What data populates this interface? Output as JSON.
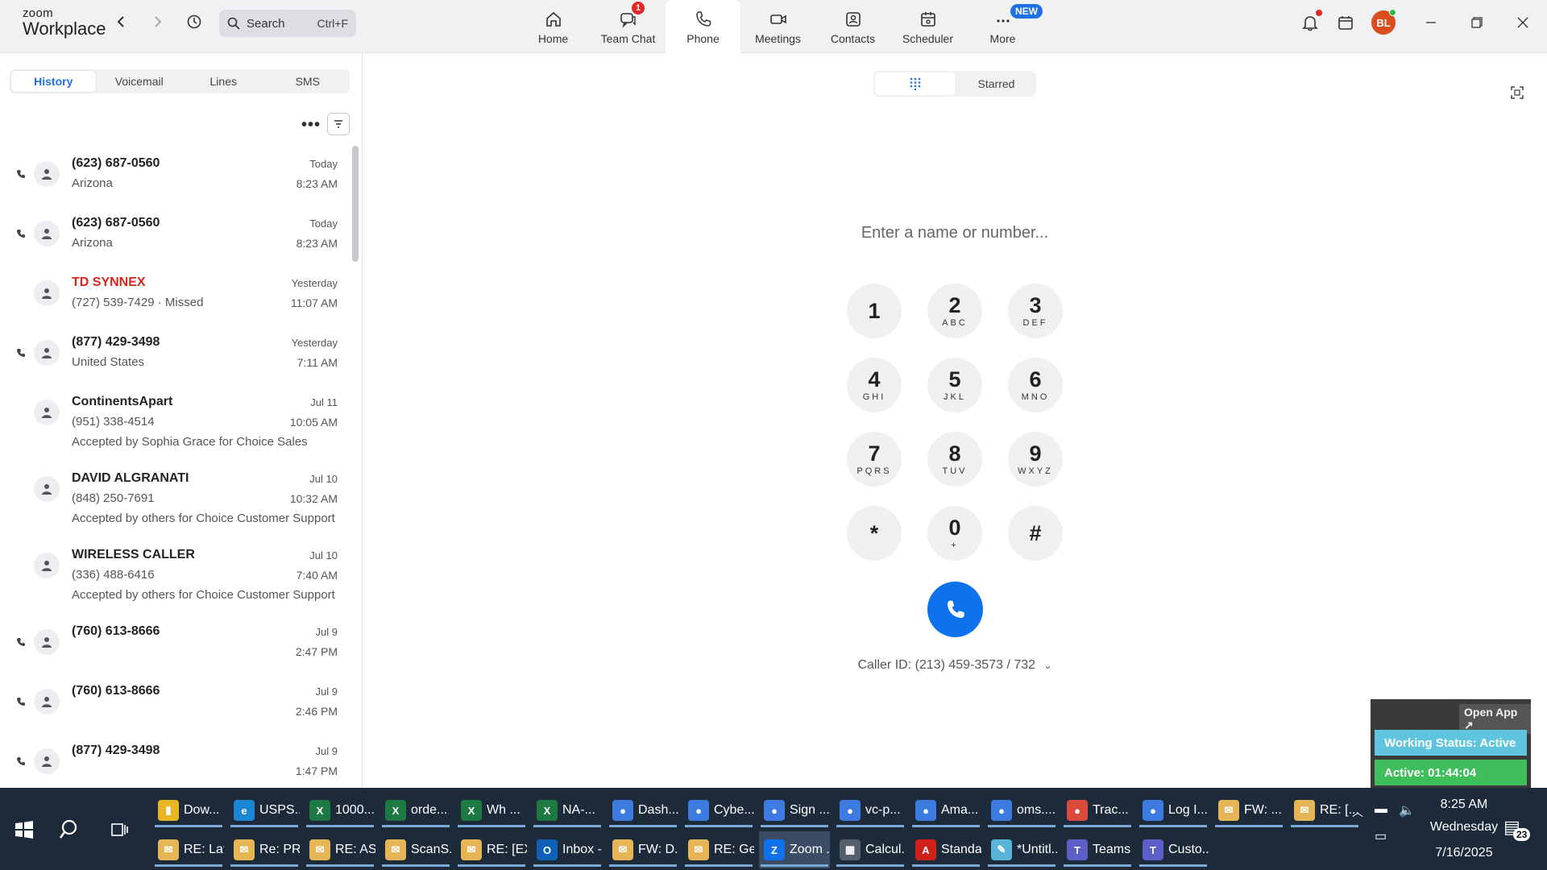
{
  "app": {
    "logo_top": "zoom",
    "logo_bottom": "Workplace"
  },
  "search": {
    "label": "Search",
    "shortcut": "Ctrl+F"
  },
  "tabs": [
    {
      "label": "Home",
      "icon": "home-icon"
    },
    {
      "label": "Team Chat",
      "icon": "chat-icon",
      "badge": "1"
    },
    {
      "label": "Phone",
      "icon": "phone-icon",
      "active": true
    },
    {
      "label": "Meetings",
      "icon": "video-icon"
    },
    {
      "label": "Contacts",
      "icon": "contacts-icon"
    },
    {
      "label": "Scheduler",
      "icon": "calendar-icon"
    },
    {
      "label": "More",
      "icon": "more-icon",
      "badge": "NEW"
    }
  ],
  "user": {
    "initials": "BL"
  },
  "phone": {
    "subtabs": [
      "History",
      "Voicemail",
      "Lines",
      "SMS"
    ],
    "active_subtab": "History",
    "more_label": "•••",
    "history": [
      {
        "name": "(623) 687-0560",
        "sub": "Arizona",
        "sub2": "",
        "day": "Today",
        "time": "8:23 AM",
        "missed": false,
        "dir": true
      },
      {
        "name": "(623) 687-0560",
        "sub": "Arizona",
        "sub2": "",
        "day": "Today",
        "time": "8:23 AM",
        "missed": false,
        "dir": true
      },
      {
        "name": "TD SYNNEX",
        "sub": "(727) 539-7429 · Missed",
        "sub2": "",
        "day": "Yesterday",
        "time": "11:07 AM",
        "missed": true,
        "dir": false
      },
      {
        "name": "(877) 429-3498",
        "sub": "United States",
        "sub2": "",
        "day": "Yesterday",
        "time": "7:11 AM",
        "missed": false,
        "dir": true
      },
      {
        "name": "ContinentsApart",
        "sub": "(951) 338-4514",
        "sub2": "Accepted by Sophia Grace for Choice Sales",
        "day": "Jul 11",
        "time": "10:05 AM",
        "missed": false,
        "dir": false
      },
      {
        "name": "DAVID ALGRANATI",
        "sub": "(848) 250-7691",
        "sub2": "Accepted by others for Choice Customer Support",
        "day": "Jul 10",
        "time": "10:32 AM",
        "missed": false,
        "dir": false
      },
      {
        "name": "WIRELESS CALLER",
        "sub": "(336) 488-6416",
        "sub2": "Accepted by others for Choice Customer Support",
        "day": "Jul 10",
        "time": "7:40 AM",
        "missed": false,
        "dir": false
      },
      {
        "name": "(760) 613-8666",
        "sub": "",
        "sub2": "",
        "day": "Jul 9",
        "time": "2:47 PM",
        "missed": false,
        "dir": true
      },
      {
        "name": "(760) 613-8666",
        "sub": "",
        "sub2": "",
        "day": "Jul 9",
        "time": "2:46 PM",
        "missed": false,
        "dir": true
      },
      {
        "name": "(877) 429-3498",
        "sub": "",
        "sub2": "",
        "day": "Jul 9",
        "time": "1:47 PM",
        "missed": false,
        "dir": true
      }
    ],
    "segments": [
      "",
      "Starred"
    ],
    "input_placeholder": "Enter a name or number...",
    "keys": [
      {
        "d": "1",
        "s": ""
      },
      {
        "d": "2",
        "s": "ABC"
      },
      {
        "d": "3",
        "s": "DEF"
      },
      {
        "d": "4",
        "s": "GHI"
      },
      {
        "d": "5",
        "s": "JKL"
      },
      {
        "d": "6",
        "s": "MNO"
      },
      {
        "d": "7",
        "s": "PQRS"
      },
      {
        "d": "8",
        "s": "TUV"
      },
      {
        "d": "9",
        "s": "WXYZ"
      },
      {
        "d": "*",
        "s": ""
      },
      {
        "d": "0",
        "s": "+"
      },
      {
        "d": "#",
        "s": ""
      }
    ],
    "caller_id": "Caller ID: (213) 459-3573 / 732"
  },
  "widget": {
    "open_app": "Open App ↗",
    "working_status": "Working Status: Active",
    "active": "Active: 01:44:04"
  },
  "taskbar": {
    "row1": [
      {
        "label": "Dow...",
        "color": "#e8b624",
        "glyph": "▮"
      },
      {
        "label": "USPS...",
        "color": "#1b86d4",
        "glyph": "e"
      },
      {
        "label": "1000...",
        "color": "#1d7a43",
        "glyph": "X"
      },
      {
        "label": "orde...",
        "color": "#1d7a43",
        "glyph": "X"
      },
      {
        "label": "Wh ...",
        "color": "#1d7a43",
        "glyph": "X"
      },
      {
        "label": "NA-...",
        "color": "#1d7a43",
        "glyph": "X"
      },
      {
        "label": "Dash...",
        "color": "#3d7be0",
        "glyph": "●"
      },
      {
        "label": "Cybe...",
        "color": "#3d7be0",
        "glyph": "●"
      },
      {
        "label": "Sign ...",
        "color": "#3d7be0",
        "glyph": "●"
      },
      {
        "label": "vc-p...",
        "color": "#3d7be0",
        "glyph": "●"
      },
      {
        "label": "Ama...",
        "color": "#3d7be0",
        "glyph": "●"
      },
      {
        "label": "oms....",
        "color": "#3d7be0",
        "glyph": "●"
      },
      {
        "label": "Trac...",
        "color": "#d94a3a",
        "glyph": "●"
      },
      {
        "label": "Log I...",
        "color": "#3d7be0",
        "glyph": "●"
      },
      {
        "label": "FW: ...",
        "color": "#e6b656",
        "glyph": "✉"
      },
      {
        "label": "RE: [...",
        "color": "#e6b656",
        "glyph": "✉"
      }
    ],
    "row2": [
      {
        "label": "RE: Lat...",
        "color": "#e6b656",
        "glyph": "✉"
      },
      {
        "label": "Re: PR...",
        "color": "#e6b656",
        "glyph": "✉"
      },
      {
        "label": "RE: AS...",
        "color": "#e6b656",
        "glyph": "✉"
      },
      {
        "label": "ScanS...",
        "color": "#e6b656",
        "glyph": "✉"
      },
      {
        "label": "RE: [EX...",
        "color": "#e6b656",
        "glyph": "✉"
      },
      {
        "label": "Inbox -...",
        "color": "#1160b8",
        "glyph": "O"
      },
      {
        "label": "FW: D...",
        "color": "#e6b656",
        "glyph": "✉"
      },
      {
        "label": "RE: Ge...",
        "color": "#e6b656",
        "glyph": "✉"
      },
      {
        "label": "Zoom ...",
        "color": "#0e72ed",
        "glyph": "Z",
        "selected": true
      },
      {
        "label": "Calcul...",
        "color": "#555e6a",
        "glyph": "▦"
      },
      {
        "label": "Standa...",
        "color": "#d0201a",
        "glyph": "A"
      },
      {
        "label": "*Untitl...",
        "color": "#5bb3d8",
        "glyph": "✎"
      },
      {
        "label": "Teams ...",
        "color": "#5b5fc7",
        "glyph": "T"
      },
      {
        "label": "Custo...",
        "color": "#5b5fc7",
        "glyph": "T"
      }
    ],
    "clock_time": "8:25 AM",
    "clock_day": "Wednesday",
    "clock_date": "7/16/2025",
    "notif_count": "23"
  }
}
